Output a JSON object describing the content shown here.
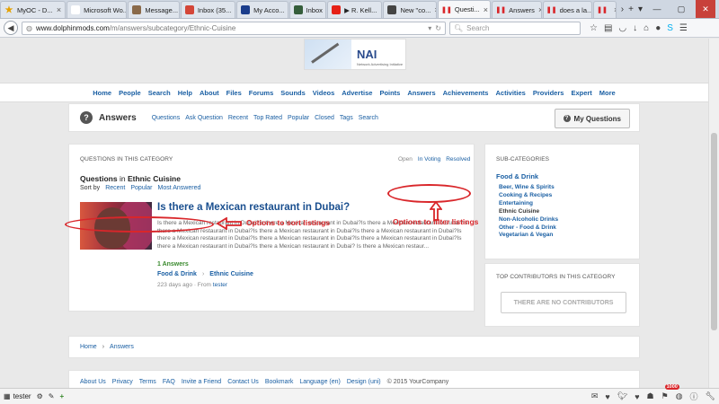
{
  "browser": {
    "tabs": [
      {
        "title": "MyOC - D...",
        "favicon": "star-icon",
        "color": "#e5a100"
      },
      {
        "title": "Microsoft Wo...",
        "favicon": "page-icon",
        "color": "#ffffff"
      },
      {
        "title": "Message...",
        "favicon": "image-icon",
        "color": "#8a6a4a"
      },
      {
        "title": "Inbox (35...",
        "favicon": "mail-icon",
        "color": "#d44638"
      },
      {
        "title": "My Acco...",
        "favicon": "paypal-icon",
        "color": "#1b3d8c"
      },
      {
        "title": "Inbox",
        "favicon": "mail-icon",
        "color": "#355e3b"
      },
      {
        "title": "▶ R. Kell...",
        "favicon": "youtube-icon",
        "color": "#e62117"
      },
      {
        "title": "New \"co...",
        "favicon": "image-icon",
        "color": "#444444"
      },
      {
        "title": "Questi...",
        "favicon": "pause-icon",
        "color": "#d9262a",
        "active": true
      },
      {
        "title": "Answers",
        "favicon": "pause-icon",
        "color": "#d9262a"
      },
      {
        "title": "does a la...",
        "favicon": "pause-icon",
        "color": "#d9262a"
      },
      {
        "title": "",
        "favicon": "pause-icon",
        "color": "#d9262a"
      }
    ],
    "url_host": "www.dolphinmods.com",
    "url_path": "/m/answers/subcategory/Ethnic-Cuisine",
    "search_placeholder": "Search"
  },
  "site": {
    "logo_text": "NAI",
    "logo_sub": "Network Advertising Initiative",
    "nav": [
      "Home",
      "People",
      "Search",
      "Help",
      "About",
      "Files",
      "Forums",
      "Sounds",
      "Videos",
      "Advertise",
      "Points",
      "Answers",
      "Achievements",
      "Activities",
      "Providers",
      "Expert",
      "More"
    ]
  },
  "answers_bar": {
    "title": "Answers",
    "links": [
      "Questions",
      "Ask Question",
      "Recent",
      "Top Rated",
      "Popular",
      "Closed",
      "Tags",
      "Search"
    ],
    "my_questions": "My Questions"
  },
  "questions": {
    "heading": "QUESTIONS IN THIS CATEGORY",
    "filters": [
      "Open",
      "In Voting",
      "Resolved"
    ],
    "title_prefix": "Questions",
    "title_in": "in",
    "title_category": "Ethnic Cuisine",
    "sort_label": "Sort by",
    "sort_options": [
      "Recent",
      "Popular",
      "Most Answered"
    ],
    "item": {
      "title": "Is there a Mexican restaurant in Dubai?",
      "excerpt": "Is there a Mexican restaurant in Dubai?Is there a Mexican restaurant in Dubai?Is there a Mexican restaurant in Dubai?Is there a Mexican restaurant in Dubai?Is there a Mexican restaurant in Dubai?Is there a Mexican restaurant in Dubai?Is there a Mexican restaurant in Dubai?Is there a Mexican restaurant in Dubai?Is there a Mexican restaurant in Dubai?Is there a Mexican restaurant in Dubai?Is there a Mexican restaurant in Dubai? Is there a Mexican restaur...",
      "answers": "1 Answers",
      "tag_parent": "Food & Drink",
      "tag_child": "Ethnic Cuisine",
      "meta": "223 days ago · From",
      "author": "tester"
    }
  },
  "subcategories": {
    "heading": "SUB-CATEGORIES",
    "parent": "Food & Drink",
    "items": [
      "Beer, Wine & Spirits",
      "Cooking & Recipes",
      "Entertaining",
      "Ethnic Cuisine",
      "Non-Alcoholic Drinks",
      "Other - Food & Drink",
      "Vegetarian & Vegan"
    ]
  },
  "contributors": {
    "heading": "TOP CONTRIBUTORS IN THIS CATEGORY",
    "empty": "THERE ARE NO CONTRIBUTORS"
  },
  "breadcrumb": [
    "Home",
    "Answers"
  ],
  "footer": {
    "links": [
      "About Us",
      "Privacy",
      "Terms",
      "FAQ",
      "Invite a Friend",
      "Contact Us",
      "Bookmark",
      "Language (en)",
      "Design (uni)"
    ],
    "copyright": "© 2015 YourCompany"
  },
  "annotations": {
    "sort": "Options to sort listings",
    "filter": "Options to filter listings",
    "color": "#d9262a"
  },
  "bottombar": {
    "user": "tester",
    "notification_count": "1000"
  }
}
